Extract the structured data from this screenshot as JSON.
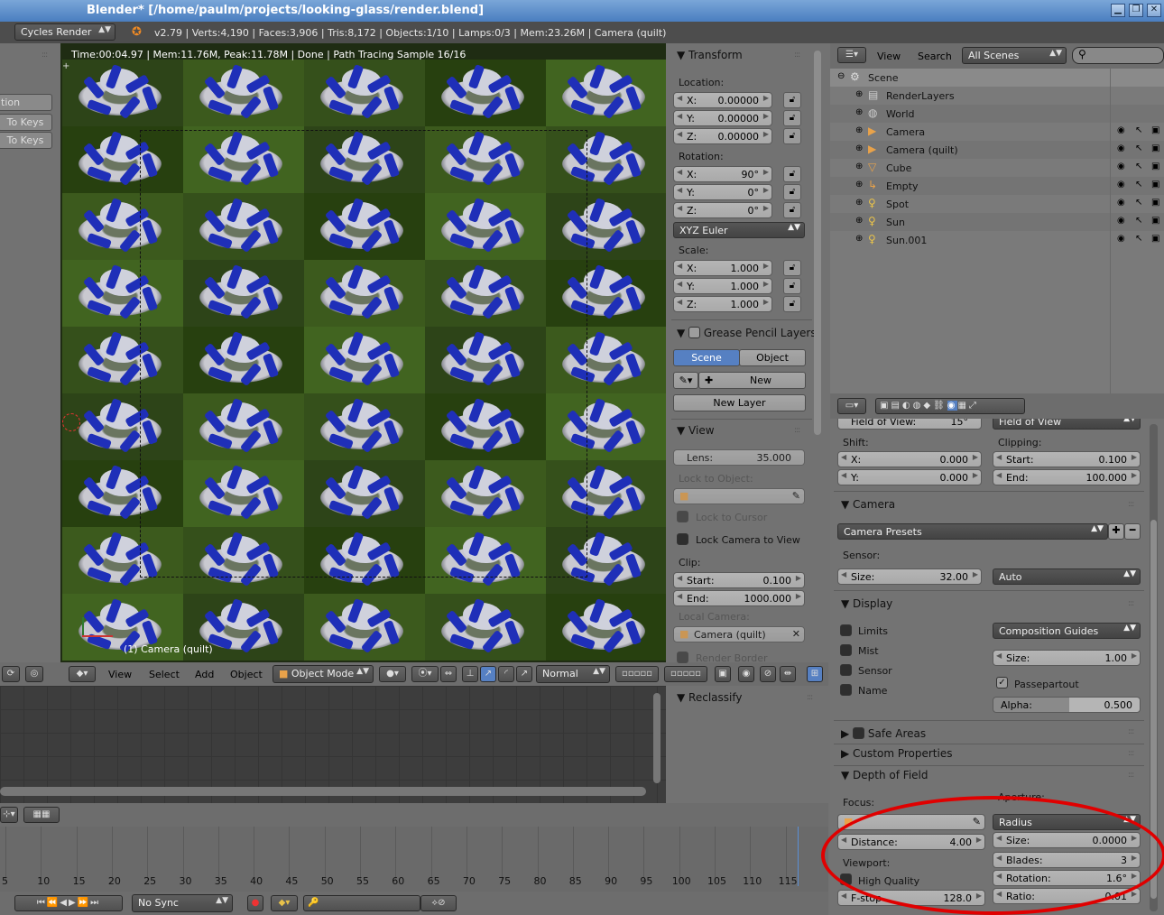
{
  "window": {
    "title": "Blender* [/home/paulm/projects/looking-glass/render.blend]",
    "controls": [
      "▁",
      "❐",
      "✕"
    ]
  },
  "infobar": {
    "engine": "Cycles Render",
    "stats": "v2.79 | Verts:4,190 | Faces:3,906 | Tris:8,172 | Objects:1/10 | Lamps:0/3 | Mem:23.26M | Camera (quilt)"
  },
  "left_panel": {
    "items": [
      "tion",
      "To Keys",
      "To Keys"
    ]
  },
  "viewport": {
    "render_info": "Time:00:04.97 | Mem:11.76M, Peak:11.78M | Done | Path Tracing Sample 16/16",
    "object_label": "(1) Camera (quilt)",
    "grid": {
      "rows": 9,
      "cols": 5
    }
  },
  "view3d_header": {
    "menus": [
      "View",
      "Select",
      "Add",
      "Object"
    ],
    "mode": "Object Mode",
    "pivot": "Normal"
  },
  "transform": {
    "header": "Transform",
    "location_label": "Location:",
    "location": [
      {
        "axis": "X:",
        "value": "0.00000"
      },
      {
        "axis": "Y:",
        "value": "0.00000"
      },
      {
        "axis": "Z:",
        "value": "0.00000"
      }
    ],
    "rotation_label": "Rotation:",
    "rotation": [
      {
        "axis": "X:",
        "value": "90°"
      },
      {
        "axis": "Y:",
        "value": "0°"
      },
      {
        "axis": "Z:",
        "value": "0°"
      }
    ],
    "rotation_mode": "XYZ Euler",
    "scale_label": "Scale:",
    "scale": [
      {
        "axis": "X:",
        "value": "1.000"
      },
      {
        "axis": "Y:",
        "value": "1.000"
      },
      {
        "axis": "Z:",
        "value": "1.000"
      }
    ]
  },
  "grease_pencil": {
    "header": "Grease Pencil Layers",
    "tab_scene": "Scene",
    "tab_object": "Object",
    "new": "New",
    "new_layer": "New Layer"
  },
  "view_panel": {
    "header": "View",
    "lens": {
      "label": "Lens:",
      "value": "35.000"
    },
    "lock_to_object": "Lock to Object:",
    "lock_to_cursor": "Lock to Cursor",
    "lock_camera_to_view": "Lock Camera to View",
    "clip_label": "Clip:",
    "clip_start": {
      "label": "Start:",
      "value": "0.100"
    },
    "clip_end": {
      "label": "End:",
      "value": "1000.000"
    },
    "local_camera_label": "Local Camera:",
    "local_camera": "Camera (quilt)",
    "render_border": "Render Border"
  },
  "reclassify": {
    "header": "Reclassify"
  },
  "outliner": {
    "header": {
      "view": "View",
      "search": "Search",
      "filter": "All Scenes"
    },
    "items": [
      {
        "name": "Scene",
        "indent": 0
      },
      {
        "name": "RenderLayers",
        "indent": 1
      },
      {
        "name": "World",
        "indent": 1
      },
      {
        "name": "Camera",
        "indent": 1
      },
      {
        "name": "Camera (quilt)",
        "indent": 1
      },
      {
        "name": "Cube",
        "indent": 1
      },
      {
        "name": "Empty",
        "indent": 1
      },
      {
        "name": "Spot",
        "indent": 1
      },
      {
        "name": "Sun",
        "indent": 1
      },
      {
        "name": "Sun.001",
        "indent": 1
      }
    ]
  },
  "props": {
    "fov_label": "Field of View:",
    "fov_value": "15°",
    "fov_mode": "Field of View",
    "shift_label": "Shift:",
    "shift_x": {
      "label": "X:",
      "value": "0.000"
    },
    "shift_y": {
      "label": "Y:",
      "value": "0.000"
    },
    "clipping_label": "Clipping:",
    "clip_start": {
      "label": "Start:",
      "value": "0.100"
    },
    "clip_end": {
      "label": "End:",
      "value": "100.000"
    },
    "camera_header": "Camera",
    "camera_presets": "Camera Presets",
    "sensor_label": "Sensor:",
    "sensor_size": {
      "label": "Size:",
      "value": "32.00"
    },
    "sensor_fit": "Auto",
    "display_header": "Display",
    "limits": "Limits",
    "mist": "Mist",
    "sensor": "Sensor",
    "name": "Name",
    "composition_guides": "Composition Guides",
    "display_size": {
      "label": "Size:",
      "value": "1.00"
    },
    "passepartout": "Passepartout",
    "alpha": {
      "label": "Alpha:",
      "value": "0.500"
    },
    "safe_areas": "Safe Areas",
    "custom_properties": "Custom Properties",
    "dof_header": "Depth of Field",
    "focus_label": "Focus:",
    "aperture_label": "Aperture:",
    "aperture_mode": "Radius",
    "distance": {
      "label": "Distance:",
      "value": "4.00"
    },
    "aperture_size": {
      "label": "Size:",
      "value": "0.0000"
    },
    "viewport_label": "Viewport:",
    "blades": {
      "label": "Blades:",
      "value": "3"
    },
    "high_quality": "High Quality",
    "rotation": {
      "label": "Rotation:",
      "value": "1.6°"
    },
    "fstop": {
      "label": "F-stop",
      "value": "128.0"
    },
    "ratio": {
      "label": "Ratio:",
      "value": "0.01"
    }
  },
  "timeline": {
    "ticks": [
      "5",
      "10",
      "15",
      "20",
      "25",
      "30",
      "35",
      "40",
      "45",
      "50",
      "55",
      "60",
      "65",
      "70",
      "75",
      "80",
      "85",
      "90",
      "95",
      "100",
      "105",
      "110",
      "115"
    ],
    "sync": "No Sync"
  },
  "colors": {
    "annotation": "#e00000",
    "accent": "#5680c2"
  }
}
